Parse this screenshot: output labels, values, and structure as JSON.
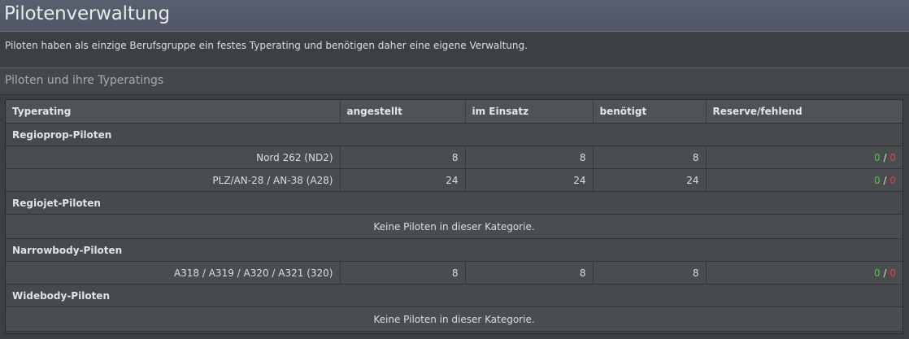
{
  "page": {
    "title": "Pilotenverwaltung",
    "intro": "Piloten haben als einzige Berufsgruppe ein festes Typerating und benötigen daher eine eigene Verwaltung.",
    "section_title": "Piloten und ihre Typeratings"
  },
  "table": {
    "headers": [
      "Typerating",
      "angestellt",
      "im Einsatz",
      "benötigt",
      "Reserve/fehlend"
    ],
    "groups": [
      {
        "name": "Regioprop-Piloten",
        "rows": [
          {
            "type": "Nord 262 (ND2)",
            "angestellt": "8",
            "im_einsatz": "8",
            "benoetigt": "8",
            "reserve": "0",
            "fehlend": "0"
          },
          {
            "type": "PLZ/AN-28 / AN-38 (A28)",
            "angestellt": "24",
            "im_einsatz": "24",
            "benoetigt": "24",
            "reserve": "0",
            "fehlend": "0"
          }
        ],
        "empty_text": ""
      },
      {
        "name": "Regiojet-Piloten",
        "rows": [],
        "empty_text": "Keine Piloten in dieser Kategorie."
      },
      {
        "name": "Narrowbody-Piloten",
        "rows": [
          {
            "type": "A318 / A319 / A320 / A321 (320)",
            "angestellt": "8",
            "im_einsatz": "8",
            "benoetigt": "8",
            "reserve": "0",
            "fehlend": "0"
          }
        ],
        "empty_text": ""
      },
      {
        "name": "Widebody-Piloten",
        "rows": [],
        "empty_text": "Keine Piloten in dieser Kategorie."
      }
    ],
    "separator": "/"
  },
  "colors": {
    "reserve": "#5fbf4c",
    "fehlend": "#e04040"
  }
}
